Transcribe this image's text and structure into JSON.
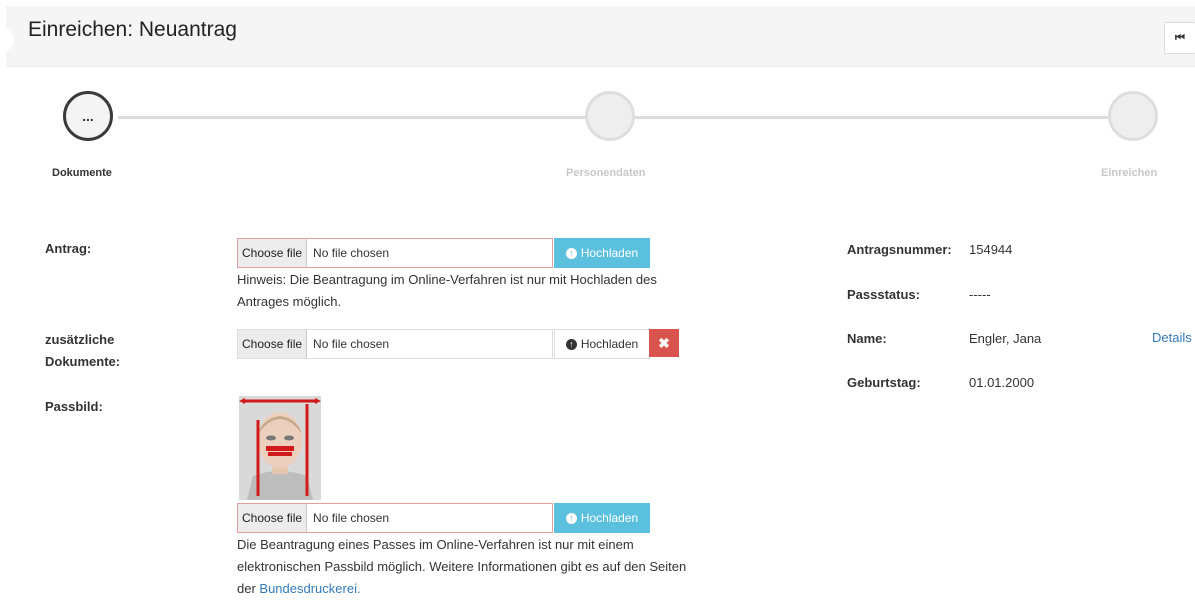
{
  "header": {
    "title": "Einreichen: Neuantrag",
    "collapse_icon": "⏮"
  },
  "stepper": {
    "steps": [
      {
        "label": "Dokumente",
        "active": true,
        "symbol": "..."
      },
      {
        "label": "Personendaten",
        "active": false
      },
      {
        "label": "Einreichen",
        "active": false
      }
    ]
  },
  "form": {
    "antrag": {
      "label": "Antrag:",
      "choose_label": "Choose file",
      "file_status": "No file chosen",
      "upload_label": "Hochladen",
      "hint_line1": "Hinweis: Die Beantragung im Online-Verfahren ist nur mit Hochladen des",
      "hint_line2": "Antrages möglich."
    },
    "zusatz": {
      "label_line1": "zusätzliche",
      "label_line2": "Dokumente:",
      "choose_label": "Choose file",
      "file_status": "No file chosen",
      "upload_label": "Hochladen",
      "delete_icon": "✖"
    },
    "passbild": {
      "label": "Passbild:",
      "choose_label": "Choose file",
      "file_status": "No file chosen",
      "upload_label": "Hochladen",
      "hint_line1": "Die Beantragung eines Passes im Online-Verfahren ist nur mit einem",
      "hint_line2": "elektronischen Passbild möglich. Weitere Informationen gibt es auf den Seiten",
      "hint_line3_prefix": "der ",
      "hint_link": "Bundesdruckerei."
    }
  },
  "info": {
    "antragsnummer_label": "Antragsnummer:",
    "antragsnummer_value": "154944",
    "passstatus_label": "Passstatus:",
    "passstatus_value": "-----",
    "name_label": "Name:",
    "name_value": "Engler, Jana",
    "details_link": "Details",
    "geburtstag_label": "Geburtstag:",
    "geburtstag_value": "01.01.2000"
  },
  "colors": {
    "accent": "#5bc0de",
    "danger": "#d9534f",
    "link": "#337ab7"
  }
}
